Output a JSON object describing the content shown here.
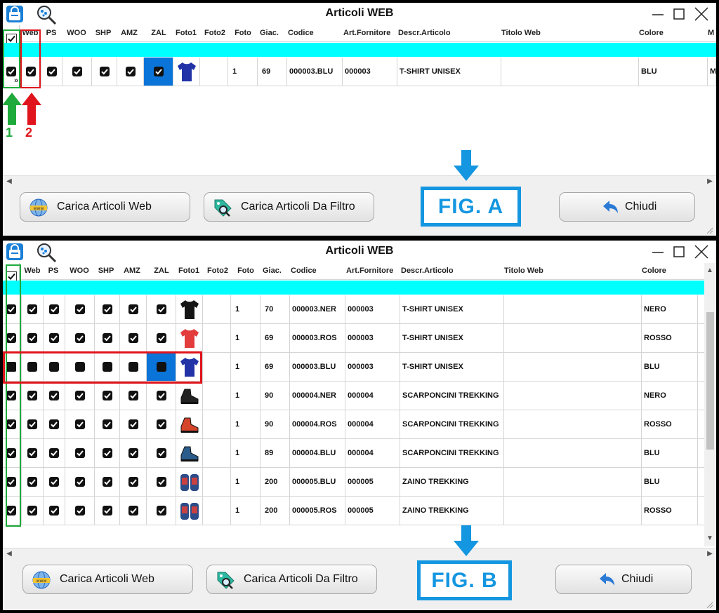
{
  "window_title": "Articoli WEB",
  "columns": {
    "web": "Web",
    "ps": "PS",
    "woo": "WOO",
    "shp": "SHP",
    "amz": "AMZ",
    "zal": "ZAL",
    "foto1": "Foto1",
    "foto2": "Foto2",
    "foto": "Foto",
    "giac": "Giac.",
    "codice": "Codice",
    "art_fornitore": "Art.Fornitore",
    "descr": "Descr.Articolo",
    "titolo": "Titolo Web",
    "colore": "Colore",
    "m": "M"
  },
  "fig_a": {
    "label": "FIG. A",
    "rows": [
      {
        "foto": "1",
        "giac": "69",
        "codice": "000003.BLU",
        "art": "000003",
        "descr": "T-SHIRT UNISEX",
        "colore": "BLU",
        "m": "M",
        "item": "tshirt-blue-icon"
      }
    ]
  },
  "fig_b": {
    "label": "FIG. B",
    "rows": [
      {
        "foto": "1",
        "giac": "70",
        "codice": "000003.NER",
        "art": "000003",
        "descr": "T-SHIRT UNISEX",
        "colore": "NERO",
        "item": "tshirt-black-icon"
      },
      {
        "foto": "1",
        "giac": "69",
        "codice": "000003.ROS",
        "art": "000003",
        "descr": "T-SHIRT UNISEX",
        "colore": "ROSSO",
        "item": "tshirt-red-icon"
      },
      {
        "foto": "1",
        "giac": "69",
        "codice": "000003.BLU",
        "art": "000003",
        "descr": "T-SHIRT UNISEX",
        "colore": "BLU",
        "item": "tshirt-blue-icon"
      },
      {
        "foto": "1",
        "giac": "90",
        "codice": "000004.NER",
        "art": "000004",
        "descr": "SCARPONCINI TREKKING",
        "colore": "NERO",
        "item": "boot-black-icon"
      },
      {
        "foto": "1",
        "giac": "90",
        "codice": "000004.ROS",
        "art": "000004",
        "descr": "SCARPONCINI TREKKING",
        "colore": "ROSSO",
        "item": "boot-red-icon"
      },
      {
        "foto": "1",
        "giac": "89",
        "codice": "000004.BLU",
        "art": "000004",
        "descr": "SCARPONCINI TREKKING",
        "colore": "BLU",
        "item": "boot-blue-icon"
      },
      {
        "foto": "1",
        "giac": "200",
        "codice": "000005.BLU",
        "art": "000005",
        "descr": "ZAINO TREKKING",
        "colore": "BLU",
        "item": "backpack-icon"
      },
      {
        "foto": "1",
        "giac": "200",
        "codice": "000005.ROS",
        "art": "000005",
        "descr": "ZAINO TREKKING",
        "colore": "ROSSO",
        "item": "backpack-icon"
      }
    ]
  },
  "buttons": {
    "carica_web": "Carica Articoli Web",
    "carica_filtro": "Carica Articoli Da Filtro",
    "chiudi": "Chiudi"
  },
  "annotations": {
    "one": "1",
    "two": "2"
  },
  "colors": {
    "accent": "#1496e0",
    "filter_row": "#00ffff",
    "selected_cell": "#0a74d8",
    "green_box": "#1faa3c",
    "red_box": "#e0141c"
  }
}
